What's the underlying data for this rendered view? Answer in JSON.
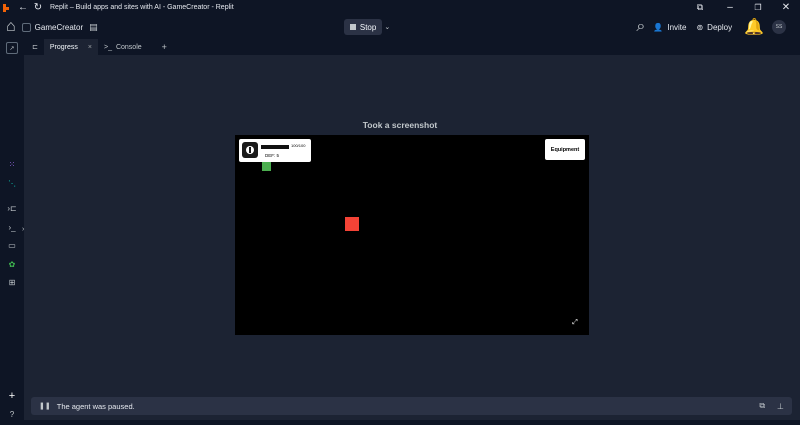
{
  "window": {
    "title": "Replit – Build apps and sites with AI - GameCreator - Replit"
  },
  "topbar": {
    "project_name": "GameCreator",
    "stop_label": "Stop",
    "invite_label": "Invite",
    "deploy_label": "Deploy",
    "user_initials": "SS"
  },
  "tabs": [
    {
      "label": "Progress"
    },
    {
      "label": "Console"
    }
  ],
  "main": {
    "heading": "Took a screenshot"
  },
  "game": {
    "hp_text": "100/100",
    "def_text": "DEF: 5",
    "equipment_label": "Equipment",
    "hp_fraction": 1.0
  },
  "status": {
    "message": "The agent was paused."
  },
  "colors": {
    "accent": "#f26207",
    "player": "#4caf50",
    "enemy": "#f44336",
    "bg": "#1c2333",
    "panel": "#0e1525"
  }
}
